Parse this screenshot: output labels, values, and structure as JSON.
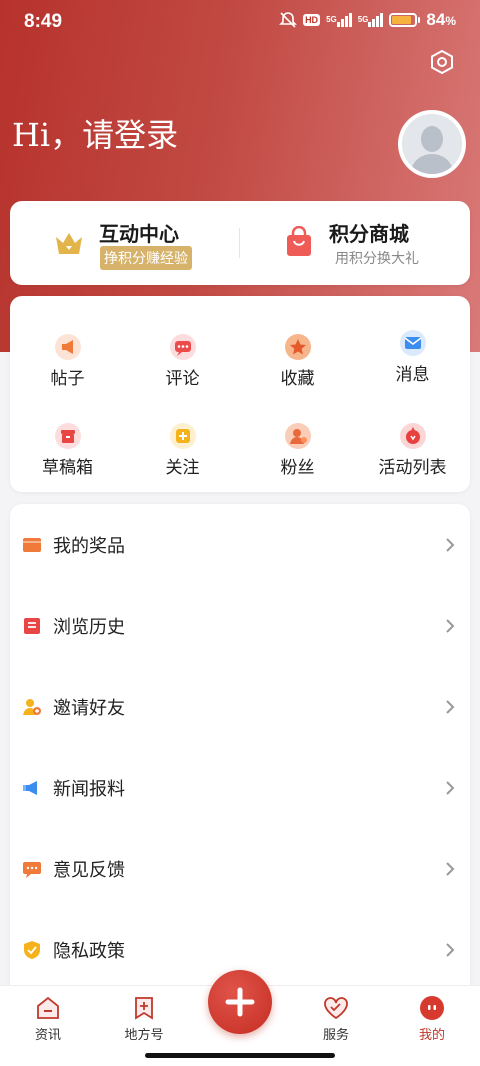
{
  "status_bar": {
    "time": "8:49",
    "hd_label": "HD",
    "sim1": "5G",
    "sim2": "5G",
    "battery_percent_text": "84",
    "battery_pct_sign": "%",
    "battery_level": 0.84
  },
  "header": {
    "greeting": "Hi，请登录"
  },
  "top_card": {
    "left": {
      "title": "互动中心",
      "badge": "挣积分赚经验"
    },
    "right": {
      "title": "积分商城",
      "subtitle": "用积分换大礼"
    }
  },
  "grid": {
    "items": [
      {
        "label": "帖子",
        "icon": "megaphone-icon"
      },
      {
        "label": "评论",
        "icon": "comment-icon"
      },
      {
        "label": "收藏",
        "icon": "star-icon"
      },
      {
        "label": "消息",
        "icon": "mail-icon"
      },
      {
        "label": "草稿箱",
        "icon": "drafts-box-icon"
      },
      {
        "label": "关注",
        "icon": "follow-plus-icon"
      },
      {
        "label": "粉丝",
        "icon": "fans-icon"
      },
      {
        "label": "活动列表",
        "icon": "activity-icon"
      }
    ]
  },
  "list": {
    "items": [
      {
        "label": "我的奖品",
        "icon": "wallet-icon"
      },
      {
        "label": "浏览历史",
        "icon": "history-icon"
      },
      {
        "label": "邀请好友",
        "icon": "invite-friend-icon"
      },
      {
        "label": "新闻报料",
        "icon": "news-tip-icon"
      },
      {
        "label": "意见反馈",
        "icon": "feedback-icon"
      },
      {
        "label": "隐私政策",
        "icon": "privacy-shield-icon"
      }
    ]
  },
  "tabbar": {
    "tabs": [
      {
        "label": "资讯",
        "icon": "news-icon"
      },
      {
        "label": "地方号",
        "icon": "local-account-icon"
      },
      {
        "label": "服务",
        "icon": "service-heart-icon"
      },
      {
        "label": "我的",
        "icon": "profile-icon"
      }
    ],
    "active_index": 3
  },
  "colors": {
    "brand_red": "#c0392b",
    "gold": "#d6b26a"
  }
}
